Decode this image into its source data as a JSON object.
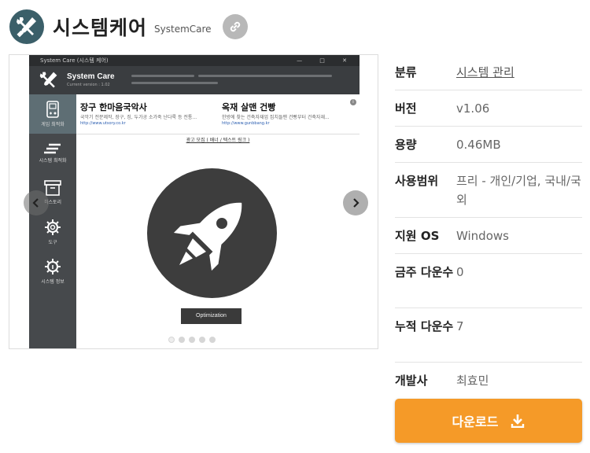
{
  "app": {
    "title": "시스템케어",
    "subtitle": "SystemCare",
    "logo_icon": "tools-icon",
    "link_icon": "link-icon"
  },
  "screenshot": {
    "window_title": "System Care (시스템 케어)",
    "window_controls": "— □ ✕",
    "header_name": "System Care",
    "header_version": "Current version : 1.02",
    "sidebar": [
      {
        "label": "게임 최적화",
        "icon": "gamepad-icon",
        "active": true
      },
      {
        "label": "시스템 최적화",
        "icon": "speed-lines-icon",
        "active": false
      },
      {
        "label": "히스토리",
        "icon": "archive-box-icon",
        "active": false
      },
      {
        "label": "도구",
        "icon": "gear-icon",
        "active": false
      },
      {
        "label": "시스템 정보",
        "icon": "gear-info-icon",
        "active": false
      }
    ],
    "ads": [
      {
        "title": "장구 한마음국악사",
        "desc": "국악기 전문제작, 장구, 징, 두가공 소가죽 난다룩 등 전통...",
        "url": "http://www.utsory.co.kr"
      },
      {
        "title": "옥재 살맨 건빵",
        "desc": "한방에 찾는 건축자재업 집치들맨 건빵부터 건축자재...",
        "url": "http://www.gunbbang.kr"
      }
    ],
    "ad_link": "광고 모집 ( 배너 / 텍스트 링크 )",
    "optimize_label": "Optimization"
  },
  "carousel": {
    "prev_icon": "chevron-left-icon",
    "next_icon": "chevron-right-icon",
    "slides": 5,
    "active_slide": 1
  },
  "info": [
    {
      "key": "분류",
      "value": "시스템 관리",
      "link": true
    },
    {
      "key": "버전",
      "value": "v1.06",
      "link": false
    },
    {
      "key": "용량",
      "value": "0.46MB",
      "link": false
    },
    {
      "key": "사용범위",
      "value": "프리 - 개인/기업, 국내/국외",
      "link": false
    },
    {
      "key": "지원 OS",
      "value": "Windows",
      "link": false
    },
    {
      "key": "금주 다운수",
      "value": "0",
      "link": false
    },
    {
      "key": "누적 다운수",
      "value": "7",
      "link": false
    },
    {
      "key": "개발사",
      "value": "최효민",
      "link": false
    }
  ],
  "download": {
    "label": "다운로드",
    "icon": "download-icon",
    "color": "#f59a28"
  }
}
